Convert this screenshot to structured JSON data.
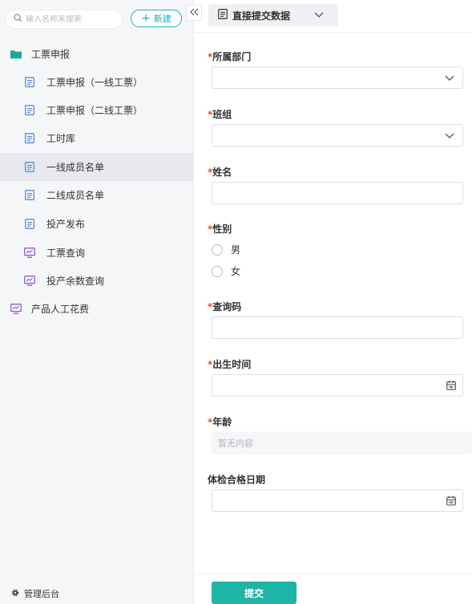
{
  "sidebar": {
    "search_placeholder": "输入名称来搜索",
    "new_button": "新建",
    "collapse_icon": "double-chevron-left",
    "items": [
      {
        "label": "工票申报",
        "icon": "folder-icon"
      },
      {
        "label": "工票申报（一线工票）",
        "icon": "form-icon"
      },
      {
        "label": "工票申报（二线工票）",
        "icon": "form-icon"
      },
      {
        "label": "工时库",
        "icon": "form-icon"
      },
      {
        "label": "一线成员名单",
        "icon": "form-icon",
        "active": true
      },
      {
        "label": "二线成员名单",
        "icon": "form-icon"
      },
      {
        "label": "投产发布",
        "icon": "form-icon"
      },
      {
        "label": "工票查询",
        "icon": "report-icon"
      },
      {
        "label": "投产余数查询",
        "icon": "report-icon"
      },
      {
        "label": "产品人工花费",
        "icon": "report-icon"
      }
    ],
    "admin_label": "管理后台"
  },
  "toolbar": {
    "mode_label": "直接提交数据"
  },
  "form": {
    "required_mark": "*",
    "department_label": "所属部门",
    "team_label": "班组",
    "name_label": "姓名",
    "gender_label": "性别",
    "gender_options": [
      "男",
      "女"
    ],
    "query_code_label": "查询码",
    "birth_label": "出生时间",
    "age_label": "年龄",
    "age_empty": "暂无内容",
    "checkup_label": "体检合格日期",
    "submit_label": "提交"
  },
  "colors": {
    "accent": "#1fb5a6",
    "required": "#e74c3c",
    "folder": "#1fa89a",
    "form_icon": "#5b8fd6",
    "report_icon": "#8e5fd1"
  }
}
